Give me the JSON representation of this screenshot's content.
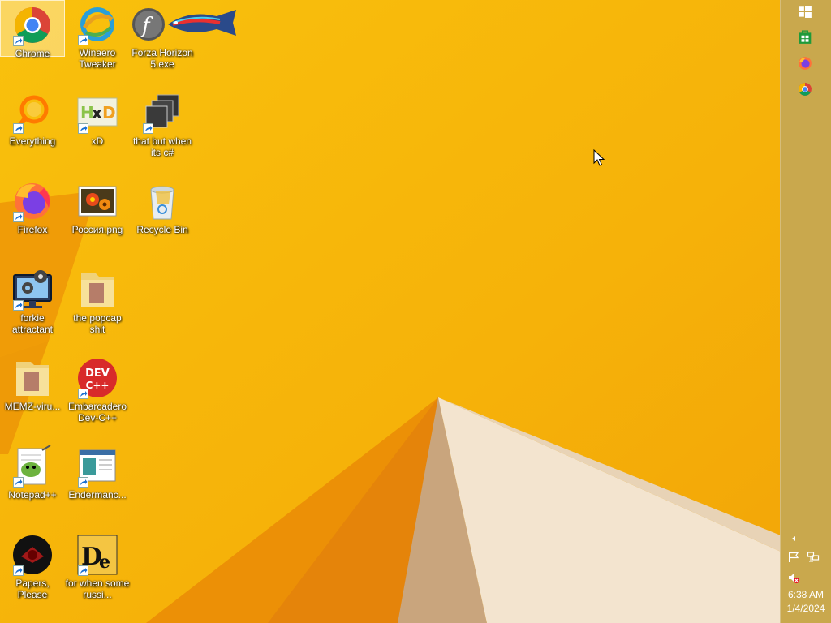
{
  "desktop": {
    "icons": [
      {
        "label": "Chrome",
        "icon": "chrome-icon"
      },
      {
        "label": "Winaero Tweaker",
        "icon": "winaero-icon"
      },
      {
        "label": "Forza Horizon 5.exe",
        "icon": "flash-fish-icon"
      },
      {
        "label": "Everything",
        "icon": "everything-search-icon"
      },
      {
        "label": "xD",
        "icon": "hxd-icon"
      },
      {
        "label": "that but when its c#",
        "icon": "stacked-windows-icon"
      },
      {
        "label": "Firefox",
        "icon": "firefox-icon"
      },
      {
        "label": "Россия.png",
        "icon": "flower-image-icon"
      },
      {
        "label": "Recycle Bin",
        "icon": "recycle-bin-icon"
      },
      {
        "label": "forkie attractant",
        "icon": "monitor-gears-icon"
      },
      {
        "label": "the popcap shit",
        "icon": "folder-icon"
      },
      {
        "label": "MEMZ-viru...",
        "icon": "folder-icon"
      },
      {
        "label": "Embarcadero Dev-C++",
        "icon": "devcpp-icon"
      },
      {
        "label": "Notepad++",
        "icon": "notepadpp-icon"
      },
      {
        "label": "Endermanc...",
        "icon": "window-app-icon"
      },
      {
        "label": "Papers, Please",
        "icon": "papers-please-icon"
      },
      {
        "label": "for when some russi...",
        "icon": "de-icon"
      }
    ]
  },
  "taskbar": {
    "buttons": [
      {
        "name": "start",
        "icon": "windows-logo-icon"
      },
      {
        "name": "store",
        "icon": "store-icon"
      },
      {
        "name": "firefox",
        "icon": "firefox-icon"
      },
      {
        "name": "chrome",
        "icon": "chrome-icon"
      }
    ],
    "tray": {
      "time": "6:38 AM",
      "date": "1/4/2024",
      "volume_state": "muted"
    }
  },
  "colors": {
    "wallpaper": "#f7b90a",
    "accent_dark": "#e8820a",
    "taskbar": "#c4a654"
  }
}
